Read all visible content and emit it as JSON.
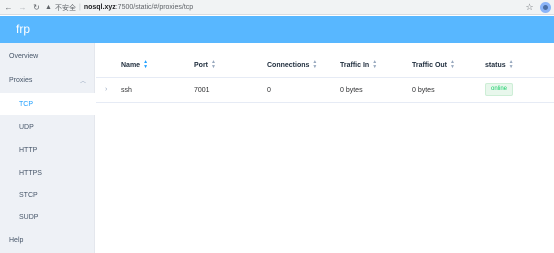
{
  "browser": {
    "security_label": "不安全",
    "url_host": "nosql.xyz",
    "url_path": ":7500/static/#/proxies/tcp"
  },
  "app": {
    "title": "frp"
  },
  "sidebar": {
    "items": [
      {
        "label": "Overview"
      },
      {
        "label": "Proxies"
      },
      {
        "label": "TCP"
      },
      {
        "label": "UDP"
      },
      {
        "label": "HTTP"
      },
      {
        "label": "HTTPS"
      },
      {
        "label": "STCP"
      },
      {
        "label": "SUDP"
      },
      {
        "label": "Help"
      }
    ],
    "active": "TCP"
  },
  "table": {
    "columns": [
      "Name",
      "Port",
      "Connections",
      "Traffic In",
      "Traffic Out",
      "status"
    ],
    "rows": [
      {
        "name": "ssh",
        "port": "7001",
        "connections": "0",
        "traffic_in": "0 bytes",
        "traffic_out": "0 bytes",
        "status": "online"
      }
    ]
  },
  "colors": {
    "header": "#58b7ff",
    "sidebar_bg": "#eef1f6",
    "active_text": "#20a0ff",
    "status_online": "#13ce66"
  }
}
